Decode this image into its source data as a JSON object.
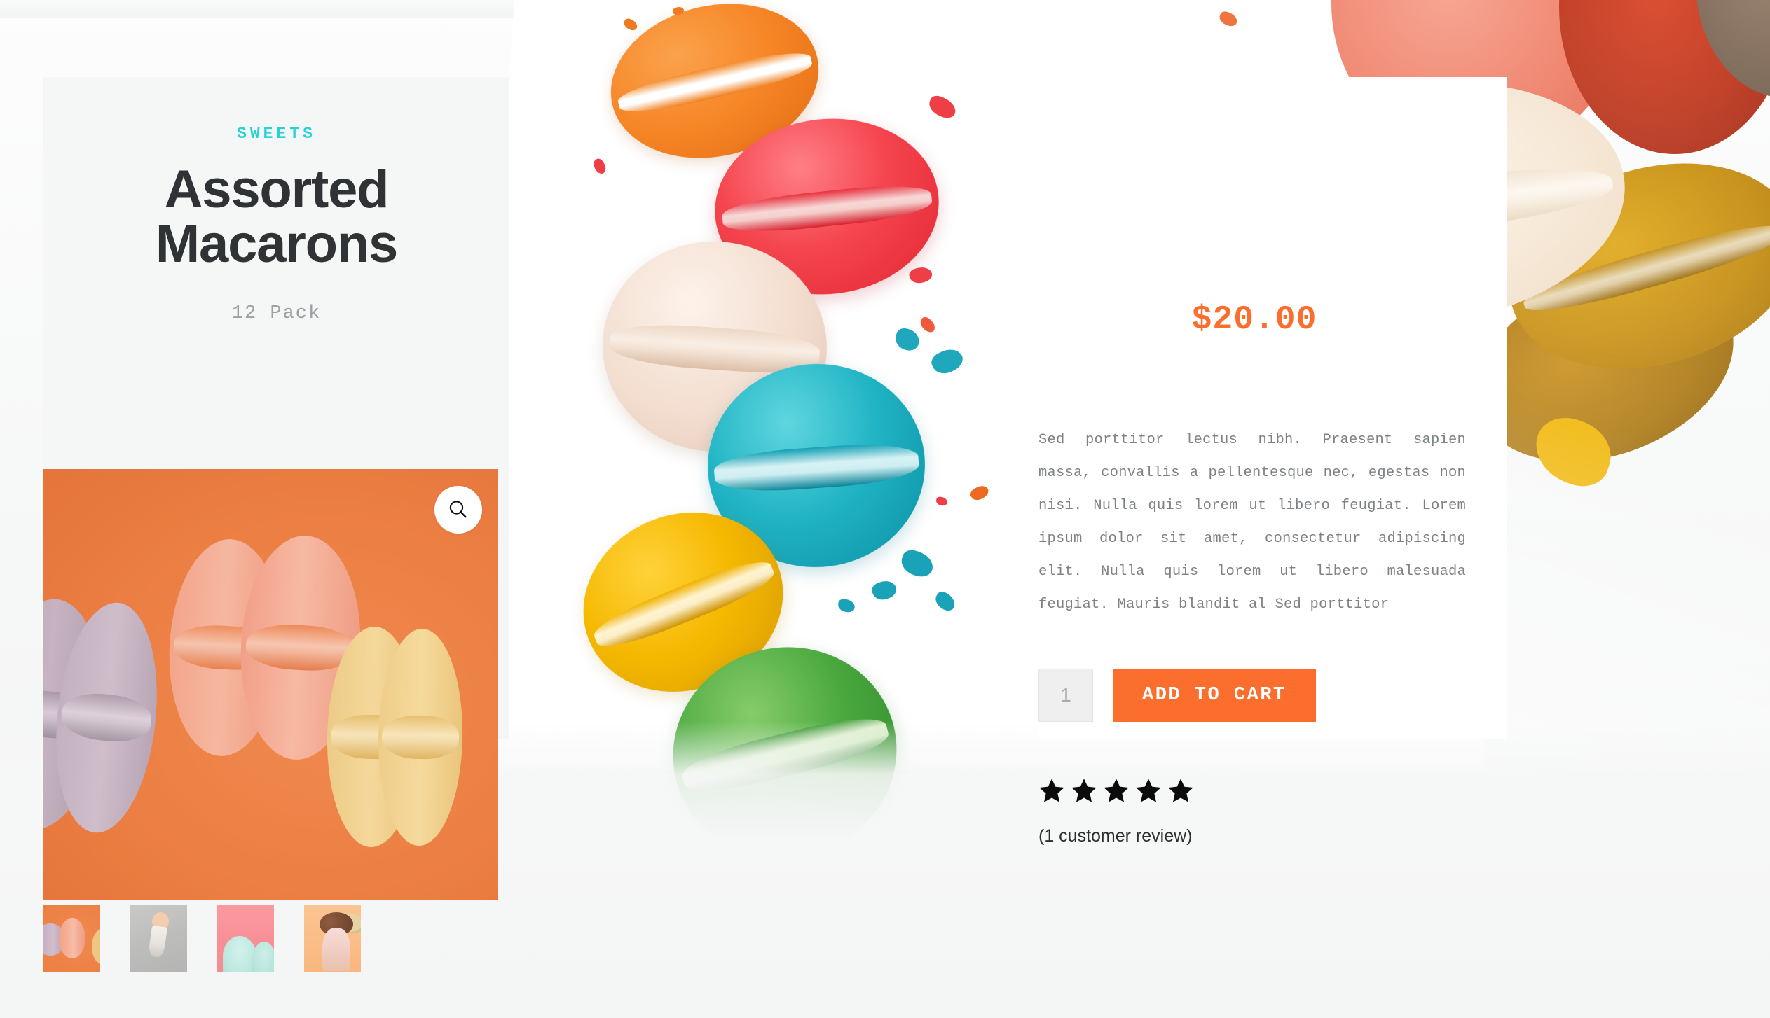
{
  "product": {
    "category": "SWEETS",
    "title_line1": "Assorted",
    "title_line2": "Macarons",
    "pack_size": "12 Pack",
    "price": "$20.00",
    "description": "Sed porttitor lectus nibh. Praesent sapien massa, convallis a pellentesque nec, egestas non nisi. Nulla quis lorem ut libero feugiat. Lorem ipsum dolor sit amet, consectetur adipiscing elit. Nulla quis lorem ut libero malesuada feugiat. Mauris blandit al Sed porttitor"
  },
  "cart": {
    "quantity_value": "1",
    "quantity_placeholder": "1",
    "add_to_cart_label": "ADD TO CART"
  },
  "reviews": {
    "stars_filled": 5,
    "stars_total": 5,
    "review_link_label": "(1 customer review)"
  },
  "gallery": {
    "zoom_icon": "magnifier-icon",
    "main_image_alt": "Assorted macarons on orange background",
    "thumbnails": [
      {
        "alt": "Macarons on orange background"
      },
      {
        "alt": "Hand holding ice cream cone on grey wall"
      },
      {
        "alt": "Mint ice cream cones on pink background"
      },
      {
        "alt": "Ice cream cone with cookies on peach background"
      }
    ]
  },
  "colors": {
    "accent_orange": "#fb6e2e",
    "accent_cyan": "#25d2d8",
    "title_dark": "#2f3336",
    "body_grey": "#7d8285",
    "panel_grey": "#f5f6f6",
    "qty_field": "#efefef",
    "star_black": "#0b0b0b"
  }
}
